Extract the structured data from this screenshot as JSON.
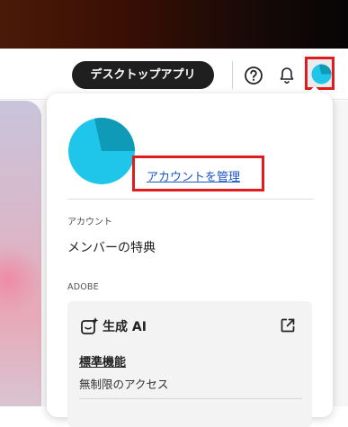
{
  "header": {
    "desktop_app_button": "デスクトップアプリ",
    "help_icon": "help-circle-icon",
    "notification_icon": "bell-icon",
    "avatar_icon": "profile-avatar-icon"
  },
  "menu": {
    "manage_account_link": "アカウントを管理",
    "account_section_label": "アカウント",
    "member_benefits_item": "メンバーの特典",
    "adobe_section_label": "ADOBE",
    "generative_ai": {
      "icon": "generative-ai-sparkle-icon",
      "title": "生成 AI",
      "external_icon": "external-link-icon",
      "plan_link": "標準機能",
      "plan_desc": "無制限のアクセス"
    }
  },
  "colors": {
    "highlight_red": "#e01c1c",
    "link_blue": "#1a56c4",
    "avatar_cyan": "#1fc6ea",
    "avatar_teal": "#0f9bb8",
    "button_dark": "#1f1f1f"
  }
}
